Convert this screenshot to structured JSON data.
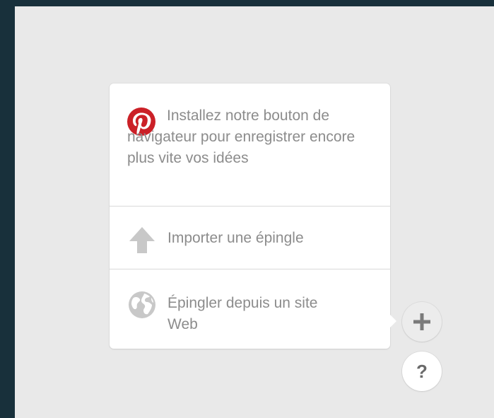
{
  "menu": {
    "browser_button_text": "Installez notre bouton de navigateur pour enregistrer encore plus vite vos idées",
    "upload_pin_label": "Importer une épingle",
    "pin_from_web_label": "Épingler depuis un site Web"
  },
  "help_button": {
    "label": "?"
  },
  "icons": {
    "browser_item": "pinterest-logo",
    "upload_item": "upload-arrow-icon",
    "web_item": "globe-icon",
    "add_button": "plus-icon",
    "help_button": "question-mark-icon"
  },
  "colors": {
    "background": "#18303b",
    "panel": "#e9e9e9",
    "card": "#ffffff",
    "text": "#8c8c8c",
    "pinterest_red": "#cb2027",
    "icon_gray": "#c8c8c8"
  }
}
